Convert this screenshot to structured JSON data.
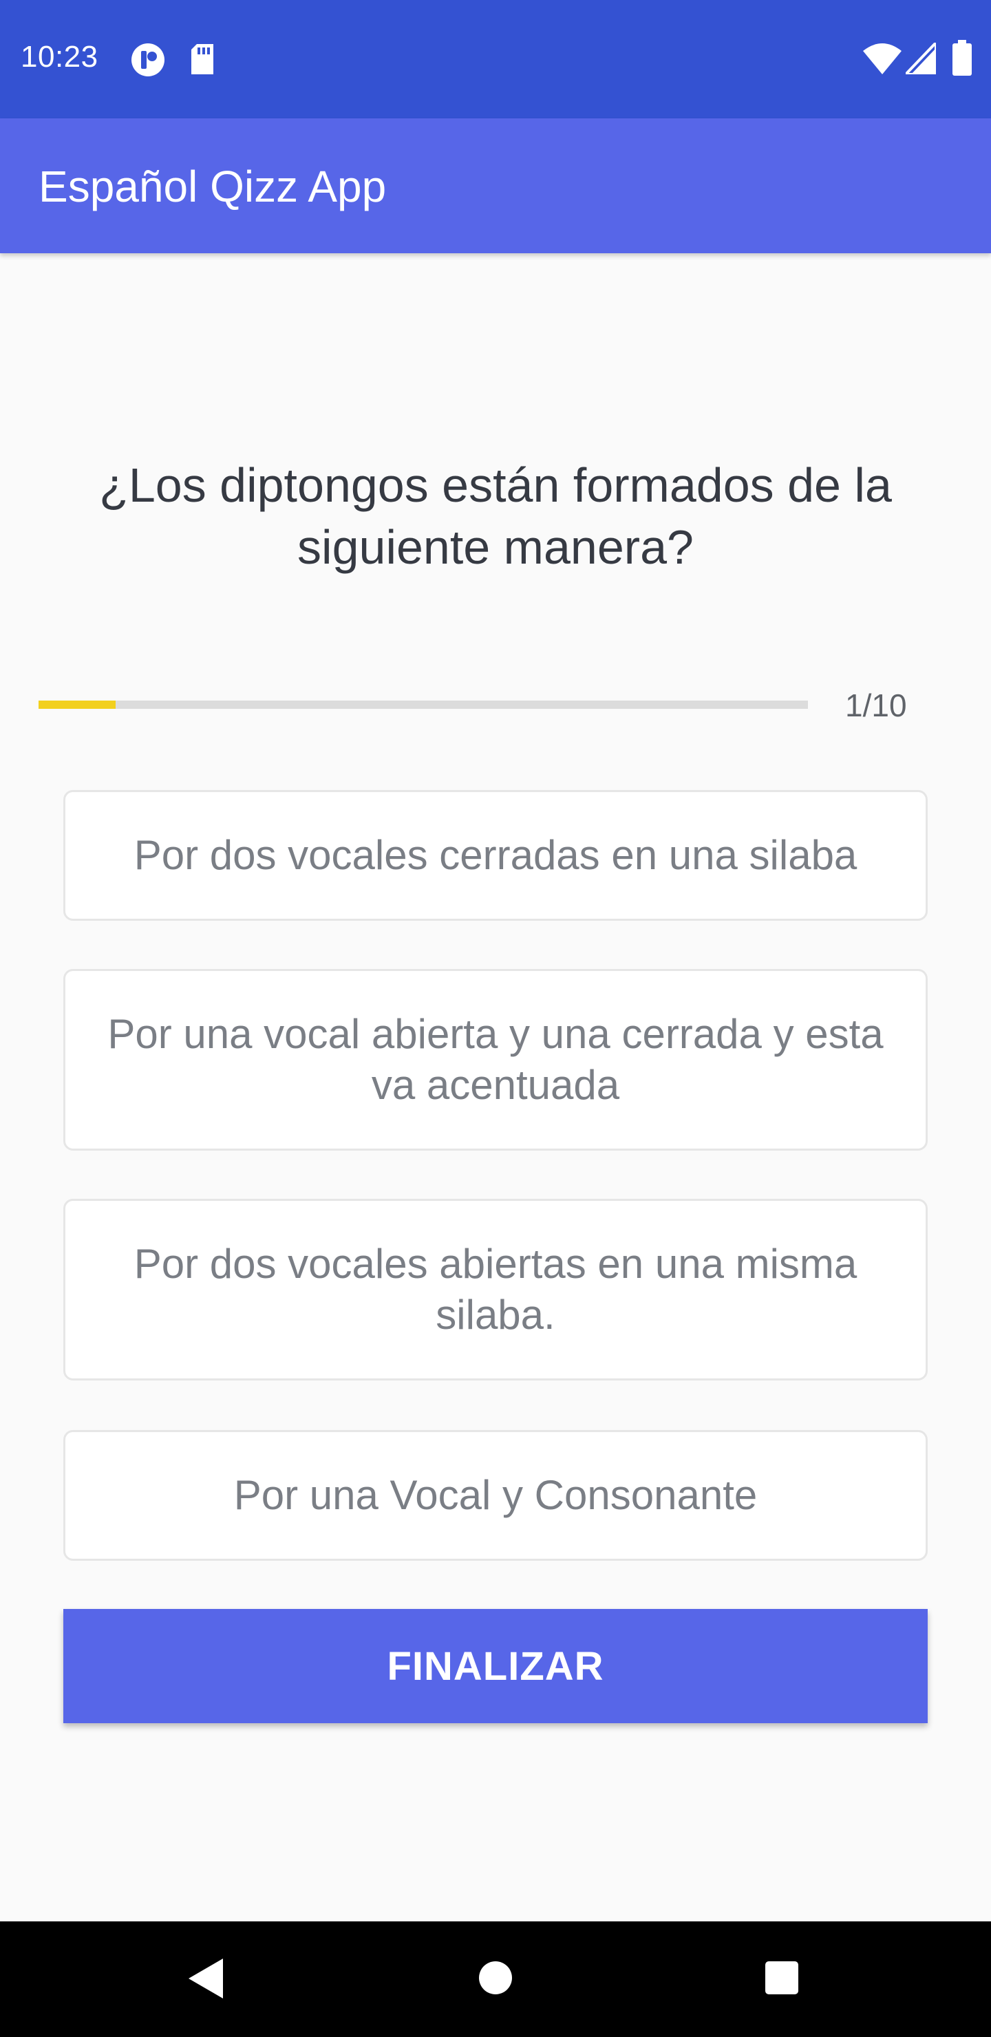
{
  "status_bar": {
    "time": "10:23",
    "icons": [
      "notification-app-icon",
      "sd-card-icon",
      "wifi-icon",
      "signal-icon",
      "battery-icon"
    ],
    "background": "#3452d2"
  },
  "app_bar": {
    "title": "Español Qizz App",
    "background": "#5766e8"
  },
  "quiz": {
    "question": "¿Los diptongos están formados de la siguiente manera?",
    "progress": {
      "current": 1,
      "total": 10,
      "label": "1/10",
      "fill_fraction": 0.1,
      "fill_color": "#f2d01e"
    },
    "options": [
      "Por dos vocales cerradas en una silaba",
      "Por una vocal abierta y una cerrada y esta va acentuada",
      "Por dos vocales abiertas en una misma silaba.",
      "Por una Vocal y Consonante"
    ],
    "finish_label": "FINALIZAR"
  },
  "nav_bar": {
    "icons": [
      "back-icon",
      "home-icon",
      "recents-icon"
    ]
  }
}
